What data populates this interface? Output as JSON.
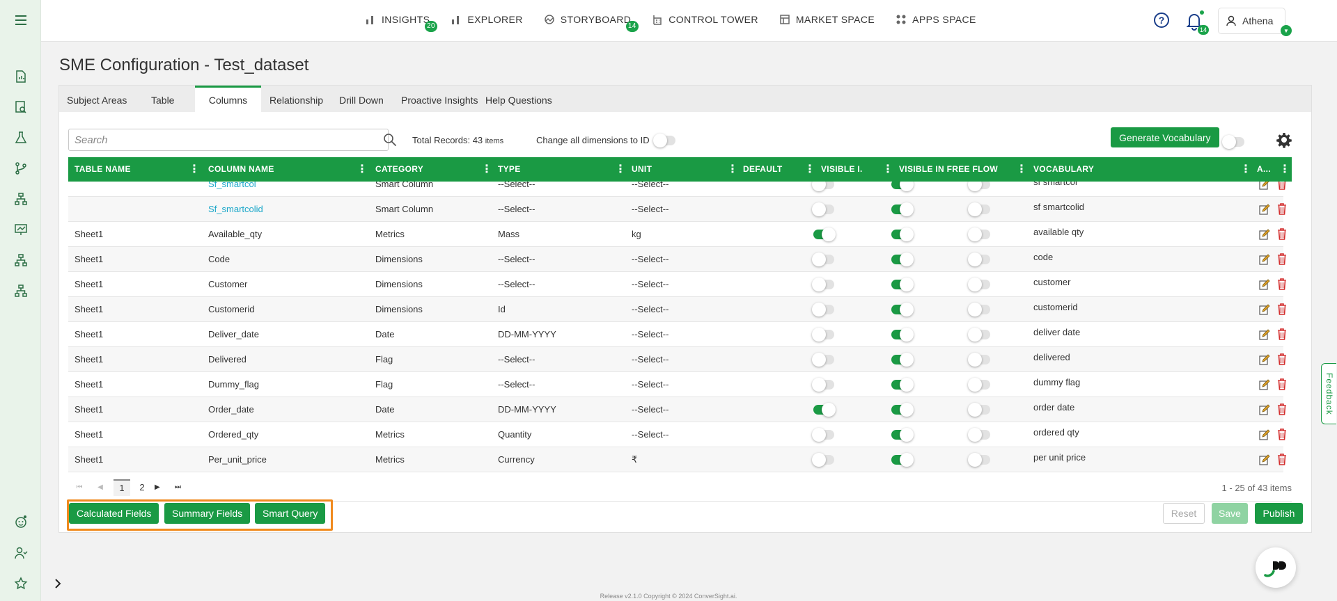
{
  "nav": {
    "items": [
      {
        "label": "INSIGHTS",
        "badge": "20",
        "icon": "bar-chart-icon"
      },
      {
        "label": "EXPLORER",
        "badge": "",
        "icon": "bar-chart-icon"
      },
      {
        "label": "STORYBOARD",
        "badge": "14",
        "icon": "storyboard-icon"
      },
      {
        "label": "CONTROL TOWER",
        "badge": "",
        "icon": "tower-icon"
      },
      {
        "label": "MARKET SPACE",
        "badge": "",
        "icon": "market-icon"
      },
      {
        "label": "APPS SPACE",
        "badge": "",
        "icon": "apps-grid-icon"
      }
    ],
    "notifications": "14",
    "user": "Athena"
  },
  "page": {
    "title": "SME Configuration - Test_dataset"
  },
  "tabs": [
    "Subject Areas",
    "Table",
    "Columns",
    "Relationship",
    "Drill Down",
    "Proactive Insights",
    "Help Questions"
  ],
  "active_tab": "Columns",
  "toolbar": {
    "search_placeholder": "Search",
    "total_label": "Total Records: 43",
    "total_unit": "items",
    "change_dims_label": "Change all dimensions to ID",
    "generate_label": "Generate Vocabulary"
  },
  "columns": [
    "TABLE NAME",
    "COLUMN NAME",
    "CATEGORY",
    "TYPE",
    "UNIT",
    "DEFAULT",
    "VISIBLE I...",
    "VISIBLE IN FREE FLOW",
    "VOCABULARY",
    "A..."
  ],
  "rows": [
    {
      "table": "",
      "column": "Sf_smartcol",
      "link": true,
      "category": "Smart Column",
      "type": "--Select--",
      "unit": "--Select--",
      "default": false,
      "visible": true,
      "free_flow": false,
      "vocab": "sf smartcol"
    },
    {
      "table": "",
      "column": "Sf_smartcolid",
      "link": true,
      "category": "Smart Column",
      "type": "--Select--",
      "unit": "--Select--",
      "default": false,
      "visible": true,
      "free_flow": false,
      "vocab": "sf smartcolid"
    },
    {
      "table": "Sheet1",
      "column": "Available_qty",
      "link": false,
      "category": "Metrics",
      "type": "Mass",
      "unit": "kg",
      "default": true,
      "visible": true,
      "free_flow": false,
      "vocab": "available qty"
    },
    {
      "table": "Sheet1",
      "column": "Code",
      "link": false,
      "category": "Dimensions",
      "type": "--Select--",
      "unit": "--Select--",
      "default": false,
      "visible": true,
      "free_flow": false,
      "vocab": "code"
    },
    {
      "table": "Sheet1",
      "column": "Customer",
      "link": false,
      "category": "Dimensions",
      "type": "--Select--",
      "unit": "--Select--",
      "default": false,
      "visible": true,
      "free_flow": false,
      "vocab": "customer"
    },
    {
      "table": "Sheet1",
      "column": "Customerid",
      "link": false,
      "category": "Dimensions",
      "type": "Id",
      "unit": "--Select--",
      "default": false,
      "visible": true,
      "free_flow": false,
      "vocab": "customerid"
    },
    {
      "table": "Sheet1",
      "column": "Deliver_date",
      "link": false,
      "category": "Date",
      "type": "DD-MM-YYYY",
      "unit": "--Select--",
      "default": false,
      "visible": true,
      "free_flow": false,
      "vocab": "deliver date"
    },
    {
      "table": "Sheet1",
      "column": "Delivered",
      "link": false,
      "category": "Flag",
      "type": "--Select--",
      "unit": "--Select--",
      "default": false,
      "visible": true,
      "free_flow": false,
      "vocab": "delivered"
    },
    {
      "table": "Sheet1",
      "column": "Dummy_flag",
      "link": false,
      "category": "Flag",
      "type": "--Select--",
      "unit": "--Select--",
      "default": false,
      "visible": true,
      "free_flow": false,
      "vocab": "dummy flag"
    },
    {
      "table": "Sheet1",
      "column": "Order_date",
      "link": false,
      "category": "Date",
      "type": "DD-MM-YYYY",
      "unit": "--Select--",
      "default": true,
      "visible": true,
      "free_flow": false,
      "vocab": "order date"
    },
    {
      "table": "Sheet1",
      "column": "Ordered_qty",
      "link": false,
      "category": "Metrics",
      "type": "Quantity",
      "unit": "--Select--",
      "default": false,
      "visible": true,
      "free_flow": false,
      "vocab": "ordered qty"
    },
    {
      "table": "Sheet1",
      "column": "Per_unit_price",
      "link": false,
      "category": "Metrics",
      "type": "Currency",
      "unit": "₹",
      "default": false,
      "visible": true,
      "free_flow": false,
      "vocab": "per unit price"
    }
  ],
  "pager": {
    "pages": [
      "1",
      "2"
    ],
    "current": "1",
    "info": "1 - 25 of 43 items"
  },
  "footer": {
    "calculated": "Calculated Fields",
    "summary": "Summary Fields",
    "smart_query": "Smart Query",
    "reset": "Reset",
    "save": "Save",
    "publish": "Publish"
  },
  "feedback": "Feedback",
  "copyright": "Release v2.1.0 Copyright © 2024 ConverSight.ai.",
  "colors": {
    "primary": "#1a9a44",
    "link": "#1ba7c9",
    "highlight": "#f08a1e",
    "danger": "#d32f2f"
  }
}
